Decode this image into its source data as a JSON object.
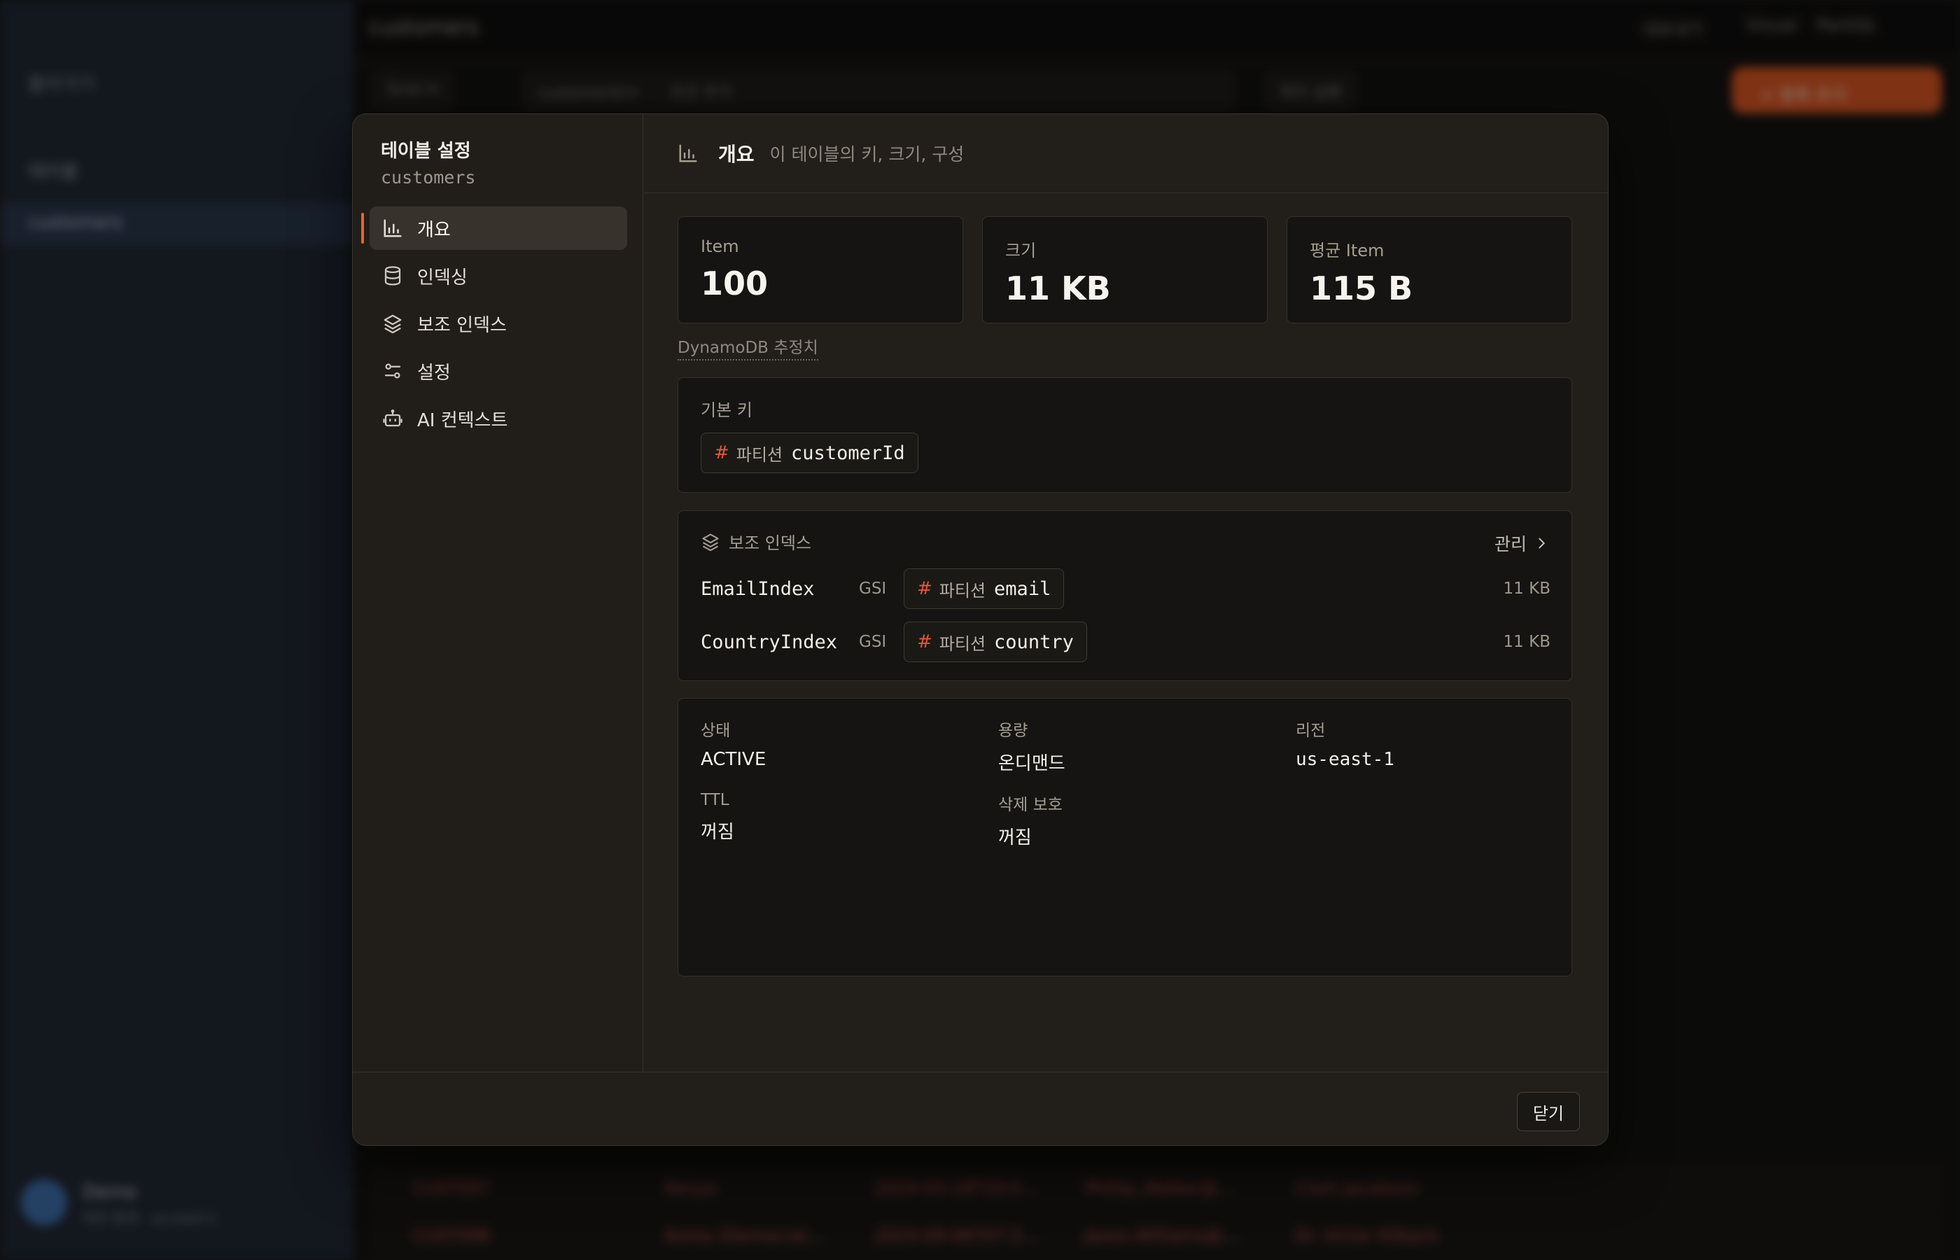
{
  "background": {
    "sidebar": {
      "back_label": "돌아가기",
      "section_label": "테이블",
      "active_table": "customers",
      "user_name": "Demo",
      "user_sub": "데모 환경 · us-east-1"
    },
    "topbar": {
      "title": "customers",
      "right_items": [
        "내보내기",
        "Visual",
        "PartiQL"
      ]
    },
    "toolbar": {
      "scan_label": "Scan ▾",
      "table_select": "customerId ▾",
      "filter_placeholder": "조건 추가",
      "query_label": "쿼리 실행",
      "primary_button": "+ 항목 추가"
    },
    "rows": [
      [
        "CUST097",
        "Kenya",
        "2024-03-18T10:0…",
        "Phillip_Walker@…",
        "Clark Jacobson"
      ],
      [
        "CUST098",
        "Korea (Democrat…",
        "2024-09-06T07:3…",
        "Jason.Williams@…",
        "Dr. Victor Kilback"
      ]
    ]
  },
  "modal": {
    "nav": {
      "title": "테이블 설정",
      "table_name": "customers",
      "items": [
        {
          "label": "개요",
          "icon": "bar-chart-icon",
          "active": true
        },
        {
          "label": "인덱싱",
          "icon": "database-icon",
          "active": false
        },
        {
          "label": "보조 인덱스",
          "icon": "layers-icon",
          "active": false
        },
        {
          "label": "설정",
          "icon": "sliders-icon",
          "active": false
        },
        {
          "label": "AI 컨텍스트",
          "icon": "robot-icon",
          "active": false
        }
      ]
    },
    "header": {
      "title": "개요",
      "description": "이 테이블의 키, 크기, 구성"
    },
    "stats": [
      {
        "label": "Item",
        "value": "100"
      },
      {
        "label": "크기",
        "value": "11 KB"
      },
      {
        "label": "평균 Item",
        "value": "115 B"
      }
    ],
    "estimate_note": "DynamoDB 추정치",
    "primary_key": {
      "label": "기본 키",
      "partition_label": "파티션",
      "partition_attr": "customerId"
    },
    "secondary_indexes": {
      "label": "보조 인덱스",
      "manage_label": "관리",
      "items": [
        {
          "name": "EmailIndex",
          "type": "GSI",
          "partition_label": "파티션",
          "attr": "email",
          "size": "11 KB"
        },
        {
          "name": "CountryIndex",
          "type": "GSI",
          "partition_label": "파티션",
          "attr": "country",
          "size": "11 KB"
        }
      ]
    },
    "properties": {
      "status_label": "상태",
      "status_value": "ACTIVE",
      "capacity_label": "용량",
      "capacity_value": "온디맨드",
      "region_label": "리전",
      "region_value": "us-east-1",
      "ttl_label": "TTL",
      "ttl_value": "꺼짐",
      "deletion_label": "삭제 보호",
      "deletion_value": "꺼짐"
    },
    "footer": {
      "close_label": "닫기"
    }
  },
  "colors": {
    "accent": "#e8642d",
    "hash": "#e2573a"
  }
}
